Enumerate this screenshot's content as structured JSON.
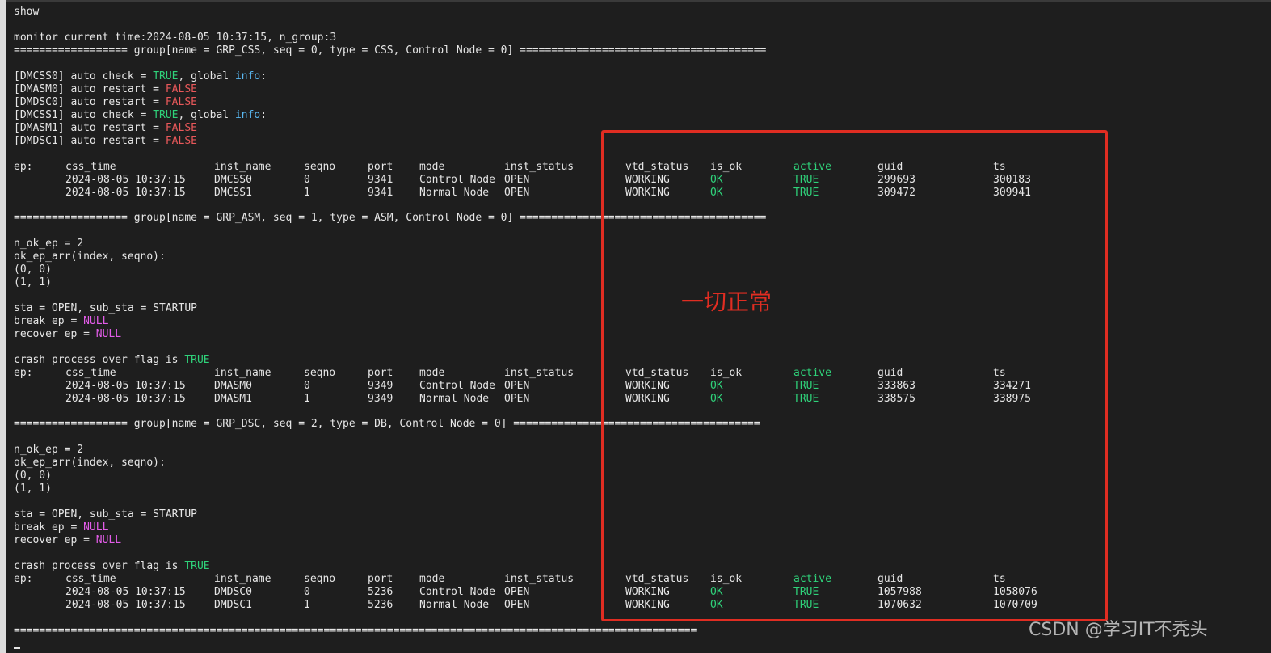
{
  "terminal": {
    "cmd": "show",
    "monitor_line": "monitor current time:2024-08-05 10:37:15, n_group:3",
    "group_headers": [
      "================== group[name = GRP_CSS, seq = 0, type = CSS, Control Node = 0] =======================================",
      "================== group[name = GRP_ASM, seq = 1, type = ASM, Control Node = 0] =======================================",
      "================== group[name = GRP_DSC, seq = 2, type = DB, Control Node = 0] ======================================="
    ],
    "footer_line": "============================================================================================================",
    "auto_lines": [
      {
        "prefix": "[DMCSS0] auto check = ",
        "value": "TRUE",
        "mid": ", global ",
        "tail": "info",
        "end": ":"
      },
      {
        "prefix": "[DMASM0] auto restart = ",
        "value": "FALSE"
      },
      {
        "prefix": "[DMDSC0] auto restart = ",
        "value": "FALSE"
      },
      {
        "prefix": "[DMCSS1] auto check = ",
        "value": "TRUE",
        "mid": ", global ",
        "tail": "info",
        "end": ":"
      },
      {
        "prefix": "[DMASM1] auto restart = ",
        "value": "FALSE"
      },
      {
        "prefix": "[DMDSC1] auto restart = ",
        "value": "FALSE"
      }
    ],
    "ep_header": {
      "ep": "ep:",
      "css_time": "css_time",
      "inst_name": "inst_name",
      "seqno": "seqno",
      "port": "port",
      "mode": "mode",
      "inst_status": "inst_status",
      "vtd_status": "vtd_status",
      "is_ok": "is_ok",
      "active": "active",
      "guid": "guid",
      "ts": "ts"
    },
    "css_rows": [
      {
        "css_time": "2024-08-05 10:37:15",
        "inst_name": "DMCSS0",
        "seqno": "0",
        "port": "9341",
        "mode": "Control Node",
        "inst_status": "OPEN",
        "vtd_status": "WORKING",
        "is_ok": "OK",
        "active": "TRUE",
        "guid": "299693",
        "ts": "300183"
      },
      {
        "css_time": "2024-08-05 10:37:15",
        "inst_name": "DMCSS1",
        "seqno": "1",
        "port": "9341",
        "mode": "Normal Node",
        "inst_status": "OPEN",
        "vtd_status": "WORKING",
        "is_ok": "OK",
        "active": "TRUE",
        "guid": "309472",
        "ts": "309941"
      }
    ],
    "asm_rows": [
      {
        "css_time": "2024-08-05 10:37:15",
        "inst_name": "DMASM0",
        "seqno": "0",
        "port": "9349",
        "mode": "Control Node",
        "inst_status": "OPEN",
        "vtd_status": "WORKING",
        "is_ok": "OK",
        "active": "TRUE",
        "guid": "333863",
        "ts": "334271"
      },
      {
        "css_time": "2024-08-05 10:37:15",
        "inst_name": "DMASM1",
        "seqno": "1",
        "port": "9349",
        "mode": "Normal Node",
        "inst_status": "OPEN",
        "vtd_status": "WORKING",
        "is_ok": "OK",
        "active": "TRUE",
        "guid": "338575",
        "ts": "338975"
      }
    ],
    "dsc_rows": [
      {
        "css_time": "2024-08-05 10:37:15",
        "inst_name": "DMDSC0",
        "seqno": "0",
        "port": "5236",
        "mode": "Control Node",
        "inst_status": "OPEN",
        "vtd_status": "WORKING",
        "is_ok": "OK",
        "active": "TRUE",
        "guid": "1057988",
        "ts": "1058076"
      },
      {
        "css_time": "2024-08-05 10:37:15",
        "inst_name": "DMDSC1",
        "seqno": "1",
        "port": "5236",
        "mode": "Normal Node",
        "inst_status": "OPEN",
        "vtd_status": "WORKING",
        "is_ok": "OK",
        "active": "TRUE",
        "guid": "1070632",
        "ts": "1070709"
      }
    ],
    "n_ok_ep": "n_ok_ep = 2",
    "ok_ep_arr": "ok_ep_arr(index, seqno):",
    "pair0": "(0, 0)",
    "pair1": "(1, 1)",
    "sta_line": "sta = OPEN, sub_sta = STARTUP",
    "break_prefix": "break ep = ",
    "recover_prefix": "recover ep = ",
    "null_value": "NULL",
    "crash_prefix": "crash process over flag is ",
    "crash_value": "TRUE"
  },
  "annotation": {
    "text": "一切正常",
    "color": "#e02d22"
  },
  "watermark": "CSDN @学习IT不秃头",
  "colors": {
    "background": "#1e1e1e",
    "text": "#e6e6e6",
    "ok_green": "#2fd27a",
    "false_red": "#e8585a",
    "info_blue": "#59b7f0",
    "null_magenta": "#e25ce8",
    "highlight_red": "#e02d22"
  }
}
